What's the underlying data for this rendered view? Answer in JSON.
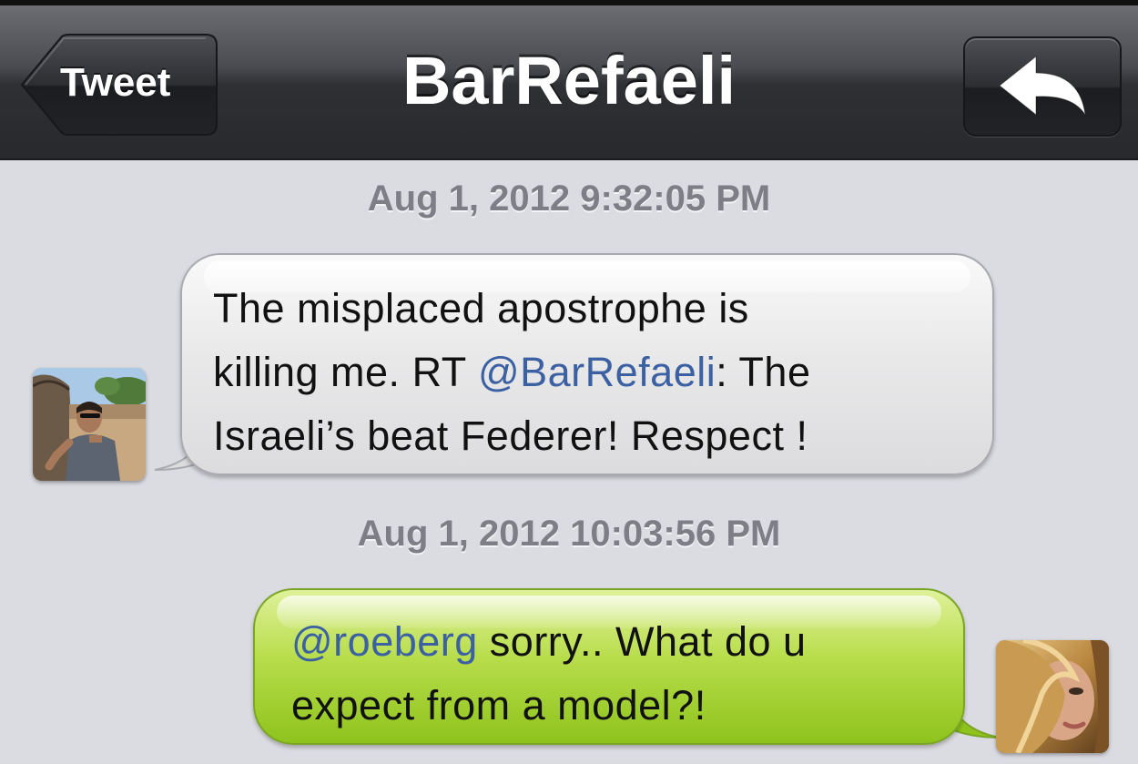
{
  "navbar": {
    "title": "BarRefaeli",
    "back_label": "Tweet"
  },
  "messages": [
    {
      "timestamp": "Aug 1, 2012 9:32:05 PM",
      "text_line1": "The misplaced apostrophe is",
      "text_line2_a": "killing me. RT ",
      "mention": "@BarRefaeli",
      "text_line2_b": ": The",
      "text_line3": "Israeli’s beat Federer! Respect !"
    },
    {
      "timestamp": "Aug 1, 2012 10:03:56 PM",
      "mention": "@roeberg",
      "text_line1_b": " sorry.. What do u",
      "text_line2": "expect from a model?!"
    }
  ],
  "colors": {
    "mention": "#3b61a3",
    "bubble_green": "#b7dd4a",
    "bubble_gray": "#e9e9ea",
    "background": "#dbdbe2"
  },
  "icons": {
    "reply": "reply-arrow-icon"
  }
}
